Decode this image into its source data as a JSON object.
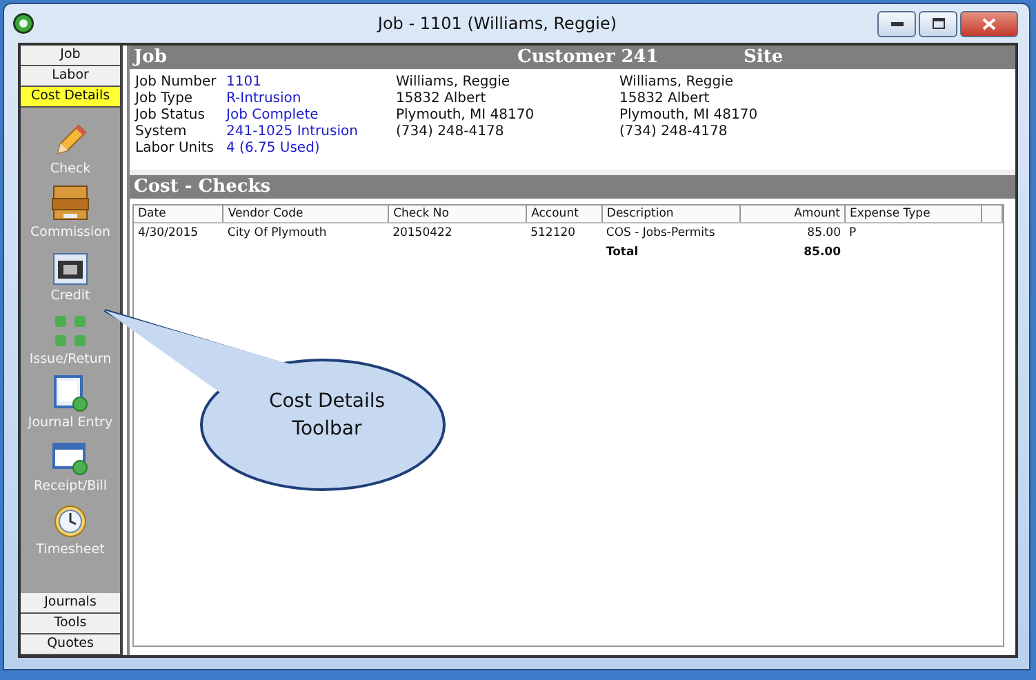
{
  "window": {
    "title": "Job - 1101 (Williams, Reggie)"
  },
  "nav_tabs": [
    {
      "label": "Job",
      "selected": false
    },
    {
      "label": "Labor",
      "selected": false
    },
    {
      "label": "Cost Details",
      "selected": true
    }
  ],
  "toolbar": [
    {
      "kind": "pencil",
      "label": "Check"
    },
    {
      "kind": "drawer",
      "label": "Commission"
    },
    {
      "kind": "card",
      "label": "Credit"
    },
    {
      "kind": "squares",
      "label": "Issue/Return"
    },
    {
      "kind": "journal",
      "label": "Journal Entry"
    },
    {
      "kind": "receipt",
      "label": "Receipt/Bill"
    },
    {
      "kind": "clock",
      "label": "Timesheet"
    }
  ],
  "bottom_tabs": [
    {
      "label": "Journals"
    },
    {
      "label": "Tools"
    },
    {
      "label": "Quotes"
    }
  ],
  "header": {
    "job": "Job",
    "customer": "Customer 241",
    "site": "Site"
  },
  "job_fields": [
    {
      "label": "Job Number",
      "value": "1101"
    },
    {
      "label": "Job Type",
      "value": "R-Intrusion"
    },
    {
      "label": "Job Status",
      "value": "Job Complete"
    },
    {
      "label": "System",
      "value": "241-1025 Intrusion"
    },
    {
      "label": "Labor Units",
      "value": "4 (6.75 Used)"
    }
  ],
  "customer_lines": [
    "Williams, Reggie",
    "15832 Albert",
    "Plymouth, MI  48170",
    "(734) 248-4178"
  ],
  "site_lines": [
    "Williams, Reggie",
    "15832 Albert",
    "Plymouth, MI  48170",
    "(734) 248-4178"
  ],
  "section_title": "Cost - Checks",
  "table": {
    "columns": [
      "Date",
      "Vendor Code",
      "Check No",
      "Account",
      "Description",
      "Amount",
      "Expense Type"
    ],
    "rows": [
      [
        "4/30/2015",
        "City Of Plymouth",
        "20150422",
        "512120",
        "COS - Jobs-Permits",
        "85.00",
        "P"
      ]
    ],
    "total": {
      "label": "Total",
      "amount": "85.00"
    }
  },
  "callout": {
    "lines": [
      "Cost Details",
      "Toolbar"
    ]
  }
}
